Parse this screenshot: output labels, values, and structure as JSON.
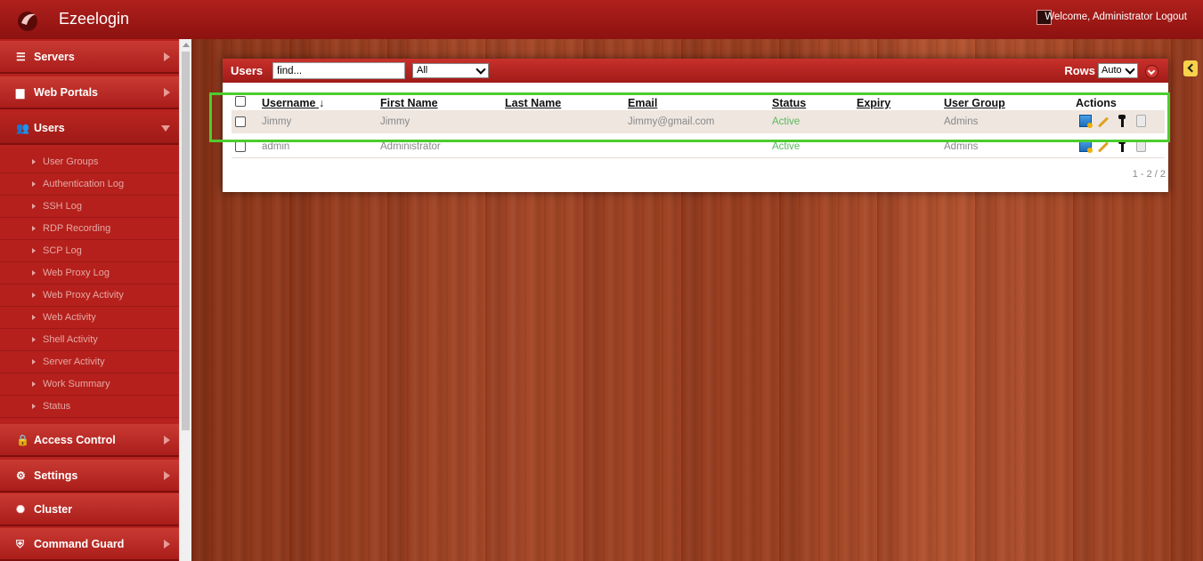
{
  "app": {
    "title": "Ezeelogin"
  },
  "header": {
    "welcome_text": "Welcome, Administrator",
    "logout_label": "Logout"
  },
  "sidebar": {
    "main_items": [
      {
        "label": "Servers",
        "icon": "list-icon"
      },
      {
        "label": "Web Portals",
        "icon": "grid-icon"
      },
      {
        "label": "Users",
        "icon": "users-icon"
      },
      {
        "label": "Access Control",
        "icon": "lock-icon"
      },
      {
        "label": "Settings",
        "icon": "gear-icon"
      },
      {
        "label": "Cluster",
        "icon": "cluster-icon"
      },
      {
        "label": "Command Guard",
        "icon": "shield-icon"
      }
    ],
    "users_subitems": [
      "User Groups",
      "Authentication Log",
      "SSH Log",
      "RDP Recording",
      "SCP Log",
      "Web Proxy Log",
      "Web Proxy Activity",
      "Web Activity",
      "Shell Activity",
      "Server Activity",
      "Work Summary",
      "Status"
    ]
  },
  "panel": {
    "title": "Users",
    "search_value": "find...",
    "filter_selected": "All",
    "rows_label": "Rows",
    "rows_selected": "Auto",
    "columns": {
      "username": "Username",
      "first_name": "First Name",
      "last_name": "Last Name",
      "email": "Email",
      "status": "Status",
      "expiry": "Expiry",
      "user_group": "User Group",
      "actions": "Actions"
    },
    "sort_indicator": "↓",
    "rows": [
      {
        "username": "Jimmy",
        "first_name": "Jimmy",
        "last_name": "",
        "email": "Jimmy@gmail.com",
        "status": "Active",
        "expiry": "",
        "user_group": "Admins"
      },
      {
        "username": "admin",
        "first_name": "Administrator",
        "last_name": "",
        "email": "",
        "status": "Active",
        "expiry": "",
        "user_group": "Admins"
      }
    ],
    "pagination": "1 - 2 / 2"
  },
  "colors": {
    "brand_red": "#b8221e",
    "status_active": "#5cb85c",
    "highlight_green": "#4ccd2e"
  }
}
